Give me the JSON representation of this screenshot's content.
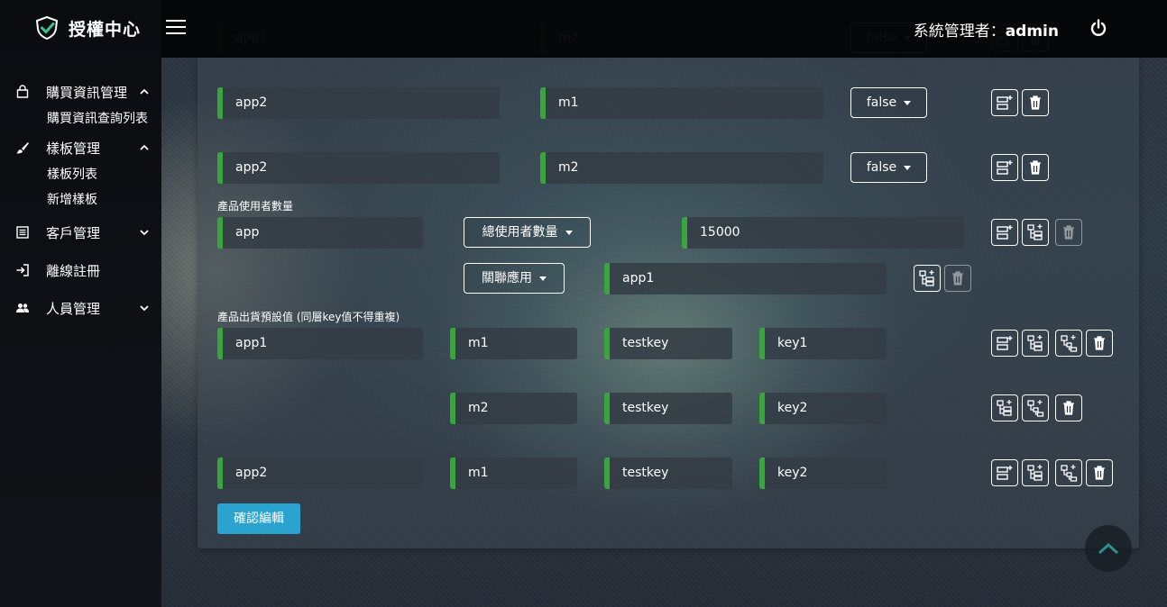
{
  "app": {
    "brand": "授權中心",
    "admin_prefix": "系統管理者：",
    "admin_name": "admin"
  },
  "sidebar": {
    "items": [
      {
        "label": "購買資訊管理",
        "icon": "bag-icon",
        "expanded": true,
        "sub": [
          "購買資訊查詢列表"
        ]
      },
      {
        "label": "樣板管理",
        "icon": "brush-icon",
        "expanded": true,
        "sub": [
          "樣板列表",
          "新增樣板"
        ]
      },
      {
        "label": "客戶管理",
        "icon": "list-icon",
        "expanded": false
      },
      {
        "label": "離線註冊",
        "icon": "sign-in-icon"
      },
      {
        "label": "人員管理",
        "icon": "users-icon",
        "expanded": false
      }
    ]
  },
  "modules": {
    "partial_row": {
      "app": "app1",
      "module": "m2",
      "value": "false"
    },
    "rows": [
      {
        "app": "app2",
        "module": "m1",
        "value": "false"
      },
      {
        "app": "app2",
        "module": "m2",
        "value": "false"
      }
    ]
  },
  "user_count": {
    "label": "產品使用者數量",
    "app": "app",
    "type_dropdown": "總使用者數量",
    "count": "15000",
    "assoc_dropdown": "關聯應用",
    "assoc_app": "app1"
  },
  "defaults": {
    "label": "產品出貨預設值 (同層key值不得重複)",
    "rows": [
      {
        "app": "app1",
        "module": "m1",
        "key": "testkey",
        "value": "key1"
      },
      {
        "app": "",
        "module": "m2",
        "key": "testkey",
        "value": "key2"
      },
      {
        "app": "app2",
        "module": "m1",
        "key": "testkey",
        "value": "key2"
      }
    ]
  },
  "confirm_label": "確認編輯"
}
